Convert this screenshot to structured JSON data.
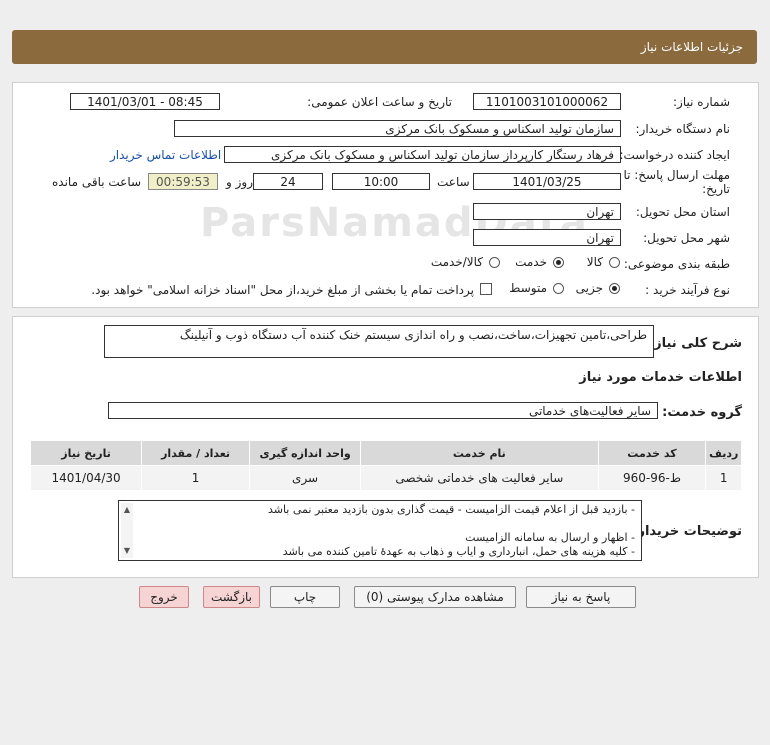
{
  "header": {
    "title": "جزئیات اطلاعات نیاز"
  },
  "form": {
    "need_number_label": "شماره نیاز:",
    "need_number": "1101003101000062",
    "announce_label": "تاریخ و ساعت اعلان عمومی:",
    "announce_value": "1401/03/01 - 08:45",
    "buyer_org_label": "نام دستگاه خریدار:",
    "buyer_org": "سازمان تولید اسکناس و مسکوک بانک مرکزی",
    "requester_label": "ایجاد کننده درخواست:",
    "requester": "فرهاد رستگار کارپرداز سازمان تولید اسکناس و مسکوک بانک مرکزی",
    "contact_link": "اطلاعات تماس خریدار",
    "deadline_label_1": "مهلت ارسال پاسخ: تا",
    "deadline_label_2": "تاریخ:",
    "deadline_date": "1401/03/25",
    "time_label": "ساعت",
    "deadline_time": "10:00",
    "days_value": "24",
    "days_label": "روز و",
    "timer_value": "00:59:53",
    "remaining_label": "ساعت باقی مانده",
    "province_label": "استان محل تحویل:",
    "province": "تهران",
    "city_label": "شهر محل تحویل:",
    "city": "تهران",
    "category_label": "طبقه بندی موضوعی:",
    "category_options": [
      "کالا",
      "خدمت",
      "کالا/خدمت"
    ],
    "category_selected": "خدمت",
    "process_label": "نوع فرآیند خرید :",
    "process_options": [
      "جزیی",
      "متوسط"
    ],
    "process_selected": "جزیی",
    "treasury_note": "پرداخت تمام یا بخشی از مبلغ خرید،از محل \"اسناد خزانه اسلامی\" خواهد بود."
  },
  "details": {
    "summary_label": "شرح کلی نیاز:",
    "summary": "طراحی،تامین تجهیزات،ساخت،نصب و راه اندازی سیستم خنک کننده آب دستگاه ذوب و آنیلینگ",
    "services_heading": "اطلاعات خدمات مورد نیاز",
    "service_group_label": "گروه خدمت:",
    "service_group": "سایر فعالیت‌های خدماتی",
    "table": {
      "headers": [
        "ردیف",
        "کد خدمت",
        "نام خدمت",
        "واحد اندازه گیری",
        "تعداد / مقدار",
        "تاریخ نیاز"
      ],
      "rows": [
        [
          "1",
          "ط-96-960",
          "سایر فعالیت های خدماتی شخصی",
          "سری",
          "1",
          "1401/04/30"
        ]
      ]
    },
    "buyer_notes_label": "توضیحات خریدار:",
    "buyer_notes": [
      "- بازدید قبل از اعلام قیمت الزامیست - قیمت گذاری بدون بازدید معتبر نمی باشد",
      "- اظهار و ارسال به سامانه الزامیست",
      "- کلیه هزینه های حمل، انبارداری و ایاب و ذهاب به عهدهٔ تامین کننده می باشد"
    ]
  },
  "buttons": {
    "reply": "پاسخ به نیاز",
    "attachments": "مشاهده مدارک پیوستی (0)",
    "print": "چاپ",
    "back": "بازگشت",
    "exit": "خروج"
  },
  "colors": {
    "header_bg": "#8b6a3e",
    "link": "#1a4fa8",
    "timer_bg": "#f0efc8"
  }
}
